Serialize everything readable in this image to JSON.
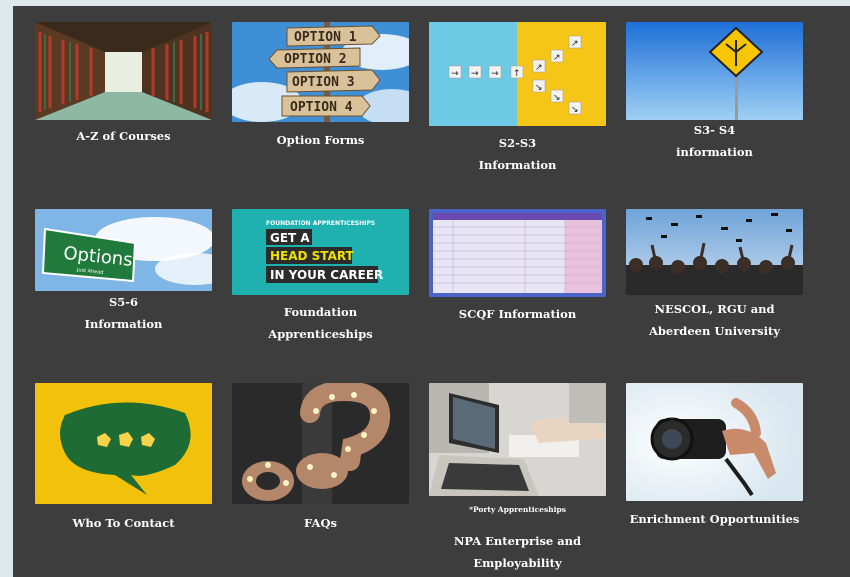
{
  "tiles": [
    {
      "id": "az",
      "caption": [
        "A-Z of Courses"
      ]
    },
    {
      "id": "options",
      "caption": [
        "Option Forms"
      ],
      "image_text": [
        "OPTION 1",
        "OPTION 2",
        "OPTION 3",
        "OPTION 4"
      ]
    },
    {
      "id": "s2s3",
      "caption": [
        "S2-S3",
        "Information"
      ]
    },
    {
      "id": "s3s4",
      "caption": [
        "S3- S4",
        "information"
      ]
    },
    {
      "id": "s56",
      "caption": [
        "S5-6",
        "Information"
      ],
      "image_text": [
        "Options",
        "Just Ahead"
      ]
    },
    {
      "id": "foundation",
      "caption": [
        "Foundation",
        "Apprenticeships"
      ],
      "image_text": [
        "FOUNDATION APPRENTICESHIPS",
        "GET A",
        "HEAD START",
        "IN YOUR CAREER"
      ]
    },
    {
      "id": "scqf",
      "caption": [
        "SCQF Information"
      ]
    },
    {
      "id": "nescol",
      "caption": [
        "NESCOL, RGU and",
        "Aberdeen University"
      ]
    },
    {
      "id": "contact",
      "caption": [
        "Who To Contact"
      ]
    },
    {
      "id": "faqs",
      "caption": [
        "FAQs"
      ]
    },
    {
      "id": "npa",
      "caption": [
        "NPA Enterprise and",
        "Employability"
      ],
      "subcaption": "*Porty Apprenticeships"
    },
    {
      "id": "enrich",
      "caption": [
        "Enrichment Opportunities"
      ]
    }
  ],
  "colors": {
    "panel": "#3d3d3d",
    "page": "#dde8ec",
    "caption": "#ffffff"
  }
}
